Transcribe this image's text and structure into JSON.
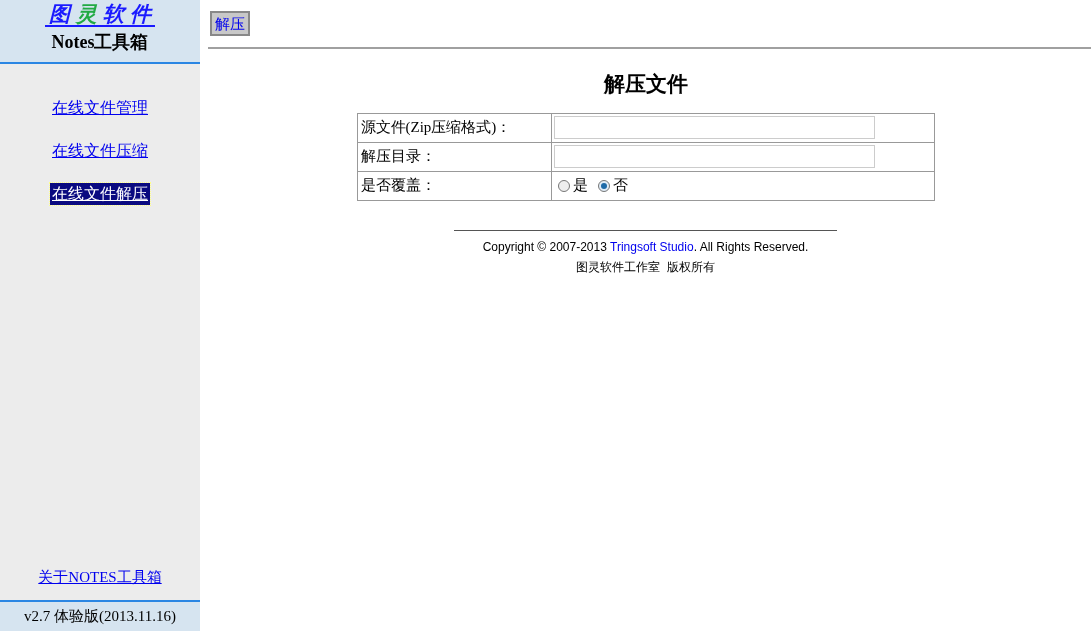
{
  "sidebar": {
    "logo": [
      {
        "char": "图",
        "color": "#1a1aff"
      },
      {
        "char": "灵",
        "color": "#22aa44"
      },
      {
        "char": "软",
        "color": "#1a1aff"
      },
      {
        "char": "件",
        "color": "#1a1aff"
      }
    ],
    "subtitle": "Notes工具箱",
    "items": [
      {
        "label": "在线文件管理",
        "selected": false
      },
      {
        "label": "在线文件压缩",
        "selected": false
      },
      {
        "label": "在线文件解压",
        "selected": true
      }
    ],
    "about_link": "关于NOTES工具箱",
    "version": "v2.7 体验版(2013.11.16)"
  },
  "toolbar": {
    "buttons": [
      "解压"
    ]
  },
  "form": {
    "title": "解压文件",
    "rows": [
      {
        "kind": "text",
        "label": "源文件(Zip压缩格式)："
      },
      {
        "kind": "text",
        "label": "解压目录："
      },
      {
        "kind": "radio",
        "label": "是否覆盖：",
        "options": [
          {
            "label": "是",
            "selected": false
          },
          {
            "label": "否",
            "selected": true
          }
        ]
      }
    ]
  },
  "footer": {
    "copyright_prefix": "Copyright © 2007-2013",
    "copyright_link": "Tringsoft Studio",
    "copyright_suffix": ". All Rights Reserved.",
    "rights": "图灵软件工作室  版权所有"
  }
}
